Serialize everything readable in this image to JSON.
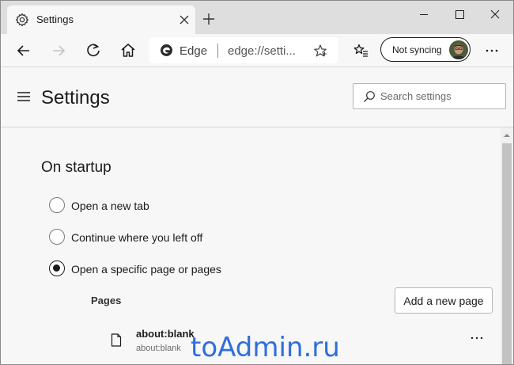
{
  "tab": {
    "title": "Settings",
    "icon": "gear-icon"
  },
  "window_controls": [
    "minimize-icon",
    "maximize-icon",
    "close-icon"
  ],
  "toolbar": {
    "address_brand": "Edge",
    "address_url": "edge://setti...",
    "sync_label": "Not syncing"
  },
  "settings": {
    "title": "Settings",
    "search_placeholder": "Search settings"
  },
  "startup": {
    "section_title": "On startup",
    "options": [
      {
        "label": "Open a new tab",
        "selected": false
      },
      {
        "label": "Continue where you left off",
        "selected": false
      },
      {
        "label": "Open a specific page or pages",
        "selected": true
      }
    ],
    "pages_label": "Pages",
    "add_page_label": "Add a new page",
    "pages": [
      {
        "name": "about:blank",
        "url": "about:blank"
      }
    ]
  },
  "watermark": "toAdmin.ru",
  "colors": {
    "tab_strip": "#dedede",
    "toolbar": "#f7f7f7",
    "watermark": "#2f6fd8"
  }
}
